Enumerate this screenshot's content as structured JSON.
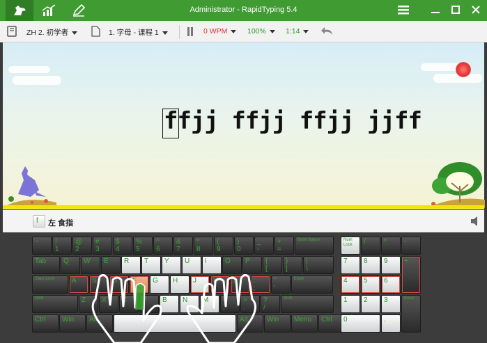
{
  "app": {
    "title": "Administrator - RapidTyping 5.4",
    "tabs": [
      {
        "icon": "kangaroo-icon"
      },
      {
        "icon": "statistics-icon"
      },
      {
        "icon": "editor-icon"
      }
    ],
    "window_buttons": [
      {
        "icon": "menu-icon"
      },
      {
        "icon": "minimize-icon"
      },
      {
        "icon": "maximize-icon"
      },
      {
        "icon": "close-icon"
      }
    ]
  },
  "toolbar": {
    "course": "ZH 2. 初学者",
    "lesson": "1. 字母 - 课程 1",
    "wpm": "0 WPM",
    "accuracy": "100%",
    "time": "1:14",
    "colors": {
      "wpm": "#e03030",
      "accuracy": "#2e9b27",
      "time": "#2e9b27"
    }
  },
  "lesson_text": "ffjj ffjj ffjj jjff",
  "hint": {
    "key": "f",
    "finger": "左 食指"
  },
  "keyboard": {
    "rows": [
      [
        "~",
        "!\n1",
        "@\n2",
        "#\n3",
        "$\n4",
        "%\n5",
        "^\n6",
        "&\n7",
        "*\n8",
        "(\n9",
        ")\n0",
        "_\n-",
        "+\n=",
        "Back Space"
      ],
      [
        "Tab",
        "Q",
        "W",
        "E",
        "R",
        "T",
        "Y",
        "U",
        "I",
        "O",
        "P",
        "{\n[",
        "}\n]",
        "|\n\\"
      ],
      [
        "Caps Lock",
        "A",
        "S",
        "D",
        "F",
        "G",
        "H",
        "J",
        "K",
        "L",
        ":\n;",
        "\"\n'",
        "Enter"
      ],
      [
        "Shift",
        "Z",
        "X",
        "C",
        "V",
        "B",
        "N",
        "M",
        "<\n,",
        ">\n.",
        "?\n/",
        "Shift"
      ],
      [
        "Ctrl",
        "Win",
        "Alt",
        "",
        "Alt",
        "Win",
        "Menu",
        "Ctrl"
      ]
    ],
    "numpad": [
      "Num\nLock",
      "/",
      "*",
      "-",
      "7",
      "8",
      "9",
      "+",
      "4",
      "5",
      "6",
      "1",
      "2",
      "3",
      "Enter",
      "0",
      "."
    ]
  }
}
